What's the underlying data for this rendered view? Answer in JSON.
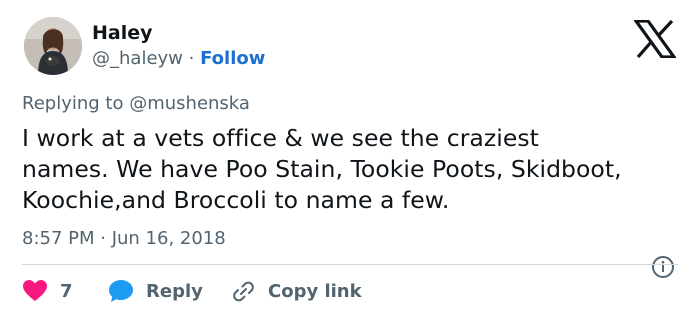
{
  "author": {
    "name": "Haley",
    "handle": "@_haleyw",
    "separator": "·",
    "follow_label": "Follow"
  },
  "reply_context": {
    "prefix": "Replying to",
    "mention": "@mushenska"
  },
  "tweet": {
    "line1": "I work at a vets office & we see the craziest",
    "line2": "names. We have Poo Stain, Tookie Poots, Skidboot,",
    "line3": "Koochie,and Broccoli to name a few.",
    "timestamp": "8:57 PM · Jun 16, 2018"
  },
  "actions": {
    "like_count": "7",
    "reply_label": "Reply",
    "copy_label": "Copy link"
  },
  "colors": {
    "text": "#0f1419",
    "muted": "#536471",
    "follow_blue": "#1d6fd0",
    "like_pink": "#f91880",
    "reply_blue": "#1d9bf0",
    "divider": "#cfd9de"
  },
  "icons": [
    "x-logo-icon",
    "heart-icon",
    "reply-bubble-icon",
    "link-icon",
    "info-icon"
  ]
}
